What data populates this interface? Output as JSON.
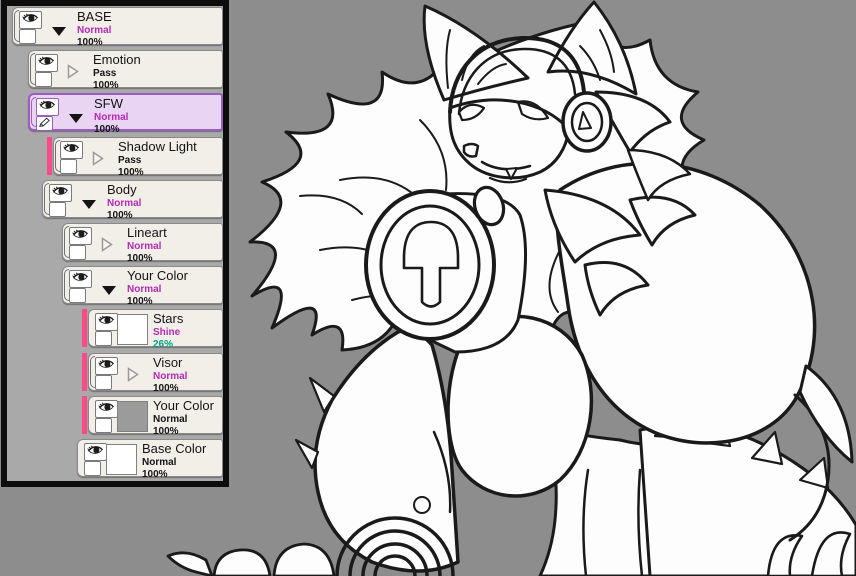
{
  "colors": {
    "canvas_bg": "#8d8d8d",
    "panel_bg": "#a9a9a9",
    "panel_border": "#0d0d0d",
    "row_bg": "#f2efe9",
    "selected_bg": "#e9d4f3",
    "selected_border": "#9a5ec2",
    "clip_stripe": "#fa4b8b",
    "mode_magenta": "#b62ab6",
    "opacity_teal": "#00a07e",
    "text_black": "#141414",
    "thumb_white": "#ffffff",
    "thumb_gray": "#9b9b9b",
    "lineart_stroke": "#1a1a1a",
    "artwork_fill": "#fdfdfd"
  },
  "layers_panel": {
    "rows": [
      {
        "name": "BASE",
        "mode": "Normal",
        "opacity": "100%",
        "depth": 0,
        "type": "folder",
        "state": "expanded",
        "clip": false,
        "selected": false,
        "thumb": null,
        "pencil": false,
        "mode_color": "magenta",
        "opacity_color": "black"
      },
      {
        "name": "Emotion",
        "mode": "Pass",
        "opacity": "100%",
        "depth": 1,
        "type": "folder",
        "state": "collapsed",
        "clip": false,
        "selected": false,
        "thumb": null,
        "pencil": false,
        "mode_color": "black",
        "opacity_color": "black"
      },
      {
        "name": "SFW",
        "mode": "Normal",
        "opacity": "100%",
        "depth": 1,
        "type": "folder",
        "state": "expanded",
        "clip": false,
        "selected": true,
        "thumb": null,
        "pencil": true,
        "mode_color": "magenta",
        "opacity_color": "black"
      },
      {
        "name": "Shadow Light",
        "mode": "Pass",
        "opacity": "100%",
        "depth": 2,
        "type": "folder",
        "state": "collapsed",
        "clip": true,
        "selected": false,
        "thumb": null,
        "pencil": false,
        "mode_color": "black",
        "opacity_color": "black"
      },
      {
        "name": "Body",
        "mode": "Normal",
        "opacity": "100%",
        "depth": 2,
        "type": "folder",
        "state": "expanded",
        "clip": false,
        "selected": false,
        "thumb": null,
        "pencil": false,
        "mode_color": "magenta",
        "opacity_color": "black"
      },
      {
        "name": "Lineart",
        "mode": "Normal",
        "opacity": "100%",
        "depth": 3,
        "type": "folder",
        "state": "collapsed",
        "clip": false,
        "selected": false,
        "thumb": null,
        "pencil": false,
        "mode_color": "magenta",
        "opacity_color": "black"
      },
      {
        "name": "Your Color",
        "mode": "Normal",
        "opacity": "100%",
        "depth": 3,
        "type": "folder",
        "state": "expanded",
        "clip": false,
        "selected": false,
        "thumb": null,
        "pencil": false,
        "mode_color": "magenta",
        "opacity_color": "black"
      },
      {
        "name": "Stars",
        "mode": "Shine",
        "opacity": "26%",
        "depth": 4,
        "type": "layer",
        "state": null,
        "clip": true,
        "selected": false,
        "thumb": "white",
        "pencil": false,
        "mode_color": "magenta",
        "opacity_color": "teal"
      },
      {
        "name": "Visor",
        "mode": "Normal",
        "opacity": "100%",
        "depth": 4,
        "type": "folder",
        "state": "collapsed",
        "clip": true,
        "selected": false,
        "thumb": null,
        "pencil": false,
        "mode_color": "magenta",
        "opacity_color": "black"
      },
      {
        "name": "Your Color",
        "mode": "Normal",
        "opacity": "100%",
        "depth": 4,
        "type": "layer",
        "state": null,
        "clip": true,
        "selected": false,
        "thumb": "gray",
        "pencil": false,
        "mode_color": "black",
        "opacity_color": "black"
      },
      {
        "name": "Base Color",
        "mode": "Normal",
        "opacity": "100%",
        "depth": 4,
        "type": "layer",
        "state": null,
        "clip": false,
        "selected": false,
        "thumb": "white",
        "pencil": false,
        "mode_color": "black",
        "opacity_color": "black"
      }
    ]
  }
}
